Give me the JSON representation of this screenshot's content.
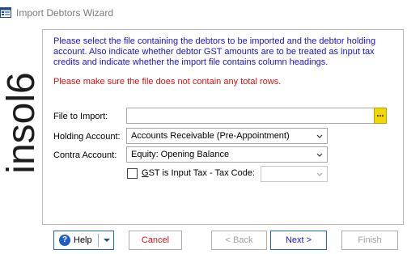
{
  "window": {
    "title": "Import Debtors Wizard"
  },
  "brand": {
    "logo_text": "insol6"
  },
  "intro_text": "Please select the file containing the debtors to be imported and the debtor holding account.  Also indicate whether debtor GST amounts are to be treated as input tax credits and indicate whether the import file contains column headings.",
  "warning_text": "Please make sure the file does not contain any total rows.",
  "form": {
    "file_label": "File to Import:",
    "file_value": "",
    "browse_label": "...",
    "holding_label": "Holding Account:",
    "holding_value": "Accounts Receivable (Pre-Appointment)",
    "contra_label": "Contra Account:",
    "contra_value": "Equity: Opening Balance",
    "gst_check_label_underlined": "G",
    "gst_check_label_rest": "ST is Input Tax - Tax Code:",
    "gst_checked": false,
    "tax_code_value": ""
  },
  "buttons": {
    "help": "Help",
    "cancel": "Cancel",
    "back": "< Back",
    "next": "Next >",
    "finish": "Finish"
  },
  "colors": {
    "intro_blue": "#1a14c8",
    "warning_red": "#d21313",
    "brand_blue": "#1e64c8",
    "browse_yellow": "#f0d800"
  }
}
